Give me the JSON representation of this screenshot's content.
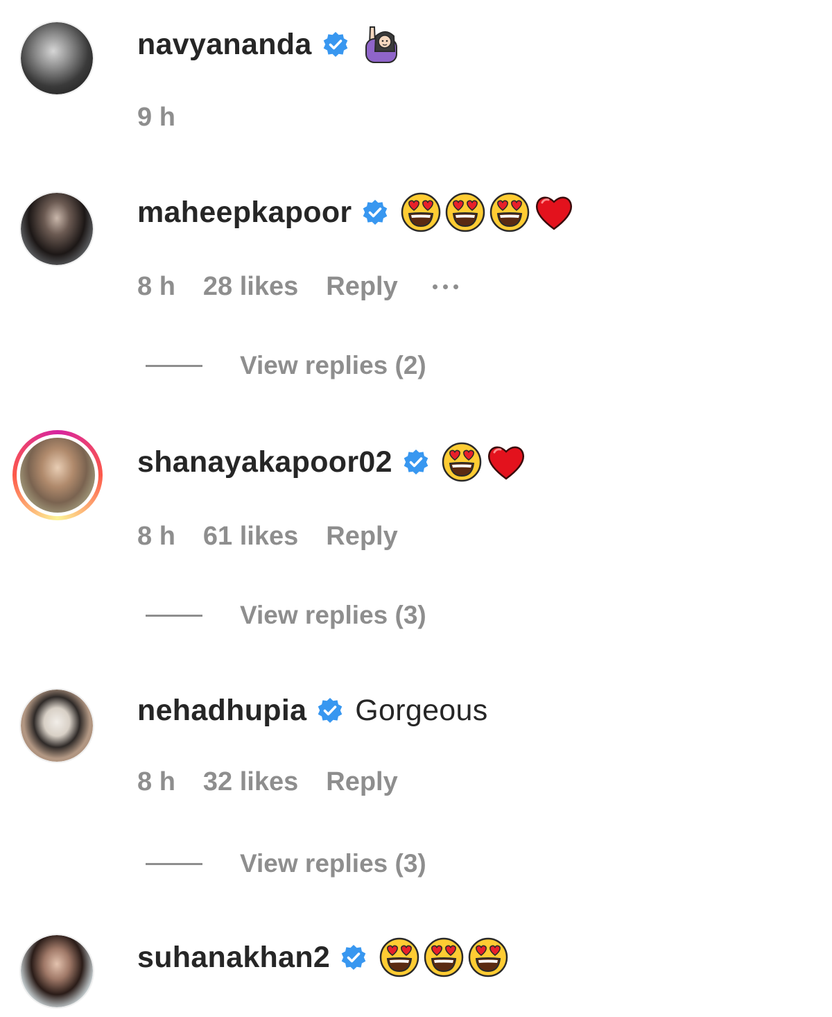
{
  "colors": {
    "text": "#262626",
    "secondary": "#8e8e8e",
    "verified": "#3897f0"
  },
  "comments": [
    {
      "username": "navyananda",
      "verified": true,
      "emojis": [
        "raising-hand-emoji"
      ],
      "time": "9 h"
    },
    {
      "username": "maheepkapoor",
      "verified": true,
      "emojis": [
        "heart-eyes-emoji",
        "heart-eyes-emoji",
        "heart-eyes-emoji",
        "red-heart-emoji"
      ],
      "time": "8 h",
      "likes": "28 likes",
      "reply": "Reply",
      "more_icon": "more-options-icon",
      "view_replies": "View replies (2)"
    },
    {
      "username": "shanayakapoor02",
      "verified": true,
      "emojis": [
        "heart-eyes-emoji",
        "red-heart-emoji"
      ],
      "time": "8 h",
      "likes": "61 likes",
      "reply": "Reply",
      "view_replies": "View replies (3)"
    },
    {
      "username": "nehadhupia",
      "verified": true,
      "text": "Gorgeous",
      "time": "8 h",
      "likes": "32 likes",
      "reply": "Reply",
      "view_replies": "View replies (3)"
    },
    {
      "username": "suhanakhan2",
      "verified": true,
      "emojis": [
        "heart-eyes-emoji",
        "heart-eyes-emoji",
        "heart-eyes-emoji"
      ]
    }
  ]
}
